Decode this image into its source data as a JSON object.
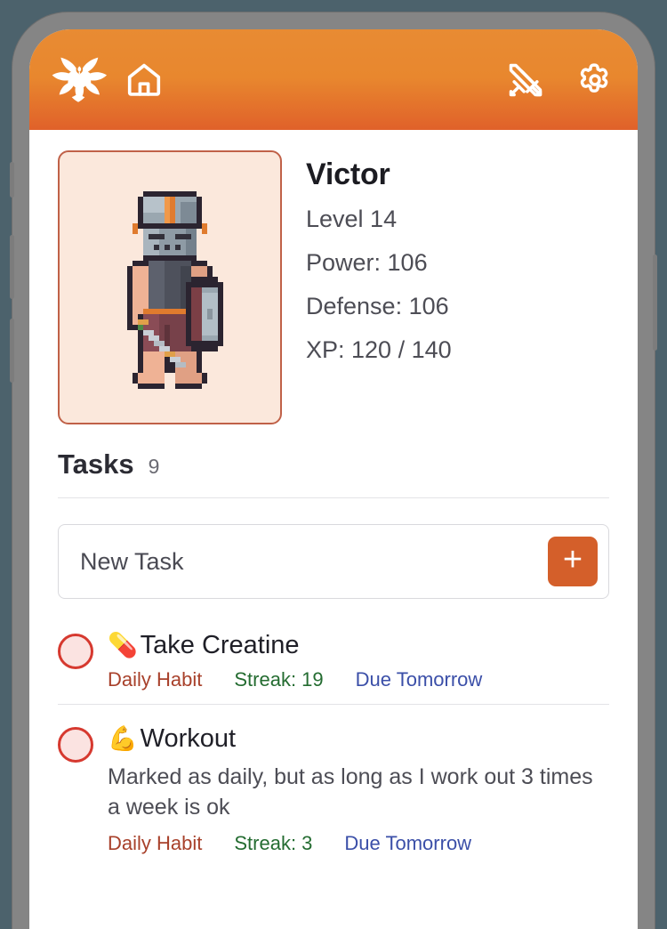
{
  "app": {
    "brand_icon": "phoenix-logo-icon",
    "nav": [
      {
        "name": "home-icon",
        "label": "Home"
      }
    ],
    "actions": [
      {
        "name": "battle-swords-icon",
        "label": "Battle"
      },
      {
        "name": "settings-gear-icon",
        "label": "Settings"
      }
    ]
  },
  "profile": {
    "avatar_alt": "pixel-art knight with sword and shield",
    "name": "Victor",
    "stats": [
      {
        "key": "level",
        "text": "Level 14"
      },
      {
        "key": "power",
        "text": "Power: 106"
      },
      {
        "key": "defense",
        "text": "Defense: 106"
      },
      {
        "key": "xp",
        "text": "XP: 120 / 140"
      }
    ],
    "level": 14,
    "power": 106,
    "defense": 106,
    "xp_current": 120,
    "xp_max": 140
  },
  "tasks_section": {
    "title": "Tasks",
    "count": "9",
    "new_task_placeholder": "New Task",
    "new_task_value": "",
    "add_button_label": "+"
  },
  "tasks": [
    {
      "emoji": "💊",
      "emoji_name": "pill-emoji",
      "title": "Take Creatine",
      "description": "",
      "habit": "Daily Habit",
      "streak": "Streak: 19",
      "due": "Due Tomorrow",
      "completed": false
    },
    {
      "emoji": "💪",
      "emoji_name": "flexed-biceps-emoji",
      "title": "Workout",
      "description": "Marked as daily, but as long as I work out 3 times a week is ok",
      "habit": "Daily Habit",
      "streak": "Streak: 3",
      "due": "Due Tomorrow",
      "completed": false
    }
  ],
  "colors": {
    "accent_orange": "#e0612a",
    "header_top": "#e88b33",
    "add_button": "#d45f2a",
    "card_bg": "#fbe8dc",
    "card_border": "#c06148",
    "check_ring": "#d6392f",
    "habit_text": "#a8412b",
    "streak_text": "#246c31",
    "due_text": "#3b4fa8",
    "page_bg": "#4c626c",
    "phone_frame": "#858585"
  }
}
